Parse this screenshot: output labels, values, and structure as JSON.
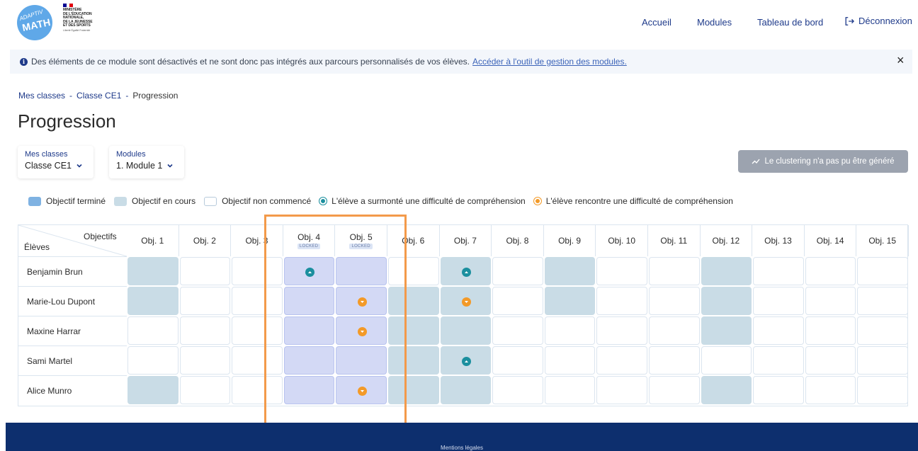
{
  "header": {
    "logo": {
      "line1": "ADAPTIV",
      "line2": "MATH"
    },
    "ministry": {
      "lines": [
        "MINISTÈRE",
        "DE L'ÉDUCATION",
        "NATIONALE,",
        "DE LA JEUNESSE",
        "ET DES SPORTS"
      ],
      "motto": "Liberté Égalité Fraternité"
    },
    "nav": {
      "home": "Accueil",
      "modules": "Modules",
      "dashboard": "Tableau de bord",
      "logout": "Déconnexion"
    }
  },
  "banner": {
    "text": "Des éléments de ce module sont désactivés et ne sont donc pas intégrés aux parcours personnalisés de vos élèves.",
    "link": "Accéder à l'outil de gestion des modules.",
    "close": "×"
  },
  "breadcrumb": {
    "items": [
      "Mes classes",
      "Classe CE1"
    ],
    "current": "Progression",
    "separator": "-"
  },
  "page_title": "Progression",
  "selectors": {
    "classes": {
      "label": "Mes classes",
      "value": "Classe CE1"
    },
    "modules": {
      "label": "Modules",
      "value": "1. Module 1"
    }
  },
  "cluster_button": "Le clustering n'a pas pu être généré",
  "legend": {
    "completed": "Objectif terminé",
    "in_progress": "Objectif en cours",
    "not_started": "Objectif non commencé",
    "overcame": "L'élève a surmonté une difficulté de compréhension",
    "struggling": "L'élève rencontre une difficulté de compréhension"
  },
  "colors": {
    "completed": "#c9dce6",
    "locked": "#d3d9f5",
    "overcame": "#1b8f9e",
    "struggling": "#f39a28",
    "primary": "#1e3a8a",
    "footer": "#0d2f6e",
    "highlight": "#f39a4a"
  },
  "table": {
    "corner_top": "Objectifs",
    "corner_bottom": "Élèves",
    "locked_label": "LOCKED",
    "objectives": [
      {
        "label": "Obj. 1",
        "locked": false
      },
      {
        "label": "Obj. 2",
        "locked": false
      },
      {
        "label": "Obj. 3",
        "locked": false
      },
      {
        "label": "Obj. 4",
        "locked": true
      },
      {
        "label": "Obj. 5",
        "locked": true
      },
      {
        "label": "Obj. 6",
        "locked": false
      },
      {
        "label": "Obj. 7",
        "locked": false
      },
      {
        "label": "Obj. 8",
        "locked": false
      },
      {
        "label": "Obj. 9",
        "locked": false
      },
      {
        "label": "Obj. 10",
        "locked": false
      },
      {
        "label": "Obj. 11",
        "locked": false
      },
      {
        "label": "Obj. 12",
        "locked": false
      },
      {
        "label": "Obj. 13",
        "locked": false
      },
      {
        "label": "Obj. 14",
        "locked": false
      },
      {
        "label": "Obj. 15",
        "locked": false
      }
    ],
    "students": [
      {
        "name": "Benjamin Brun",
        "cells": [
          "done",
          "none",
          "none",
          "done",
          "done",
          "none",
          "done",
          "none",
          "done",
          "none",
          "none",
          "done",
          "none",
          "none",
          "none"
        ],
        "markers": {
          "3": "overcame",
          "6": "overcame"
        }
      },
      {
        "name": "Marie-Lou Dupont",
        "cells": [
          "done",
          "none",
          "none",
          "done",
          "done",
          "done",
          "done",
          "none",
          "done",
          "none",
          "none",
          "done",
          "none",
          "none",
          "none"
        ],
        "markers": {
          "4": "struggling",
          "6": "struggling"
        }
      },
      {
        "name": "Maxine Harrar",
        "cells": [
          "none",
          "none",
          "none",
          "done",
          "done",
          "done",
          "done",
          "none",
          "none",
          "none",
          "none",
          "done",
          "none",
          "none",
          "none"
        ],
        "markers": {
          "4": "struggling"
        }
      },
      {
        "name": "Sami Martel",
        "cells": [
          "none",
          "none",
          "none",
          "done",
          "done",
          "done",
          "done",
          "none",
          "none",
          "none",
          "none",
          "none",
          "none",
          "none",
          "none"
        ],
        "markers": {
          "6": "overcame"
        }
      },
      {
        "name": "Alice Munro",
        "cells": [
          "done",
          "none",
          "none",
          "done",
          "done",
          "done",
          "done",
          "none",
          "none",
          "none",
          "none",
          "done",
          "none",
          "none",
          "none"
        ],
        "markers": {
          "4": "struggling"
        }
      }
    ]
  },
  "footer": {
    "link": "Mentions légales"
  }
}
